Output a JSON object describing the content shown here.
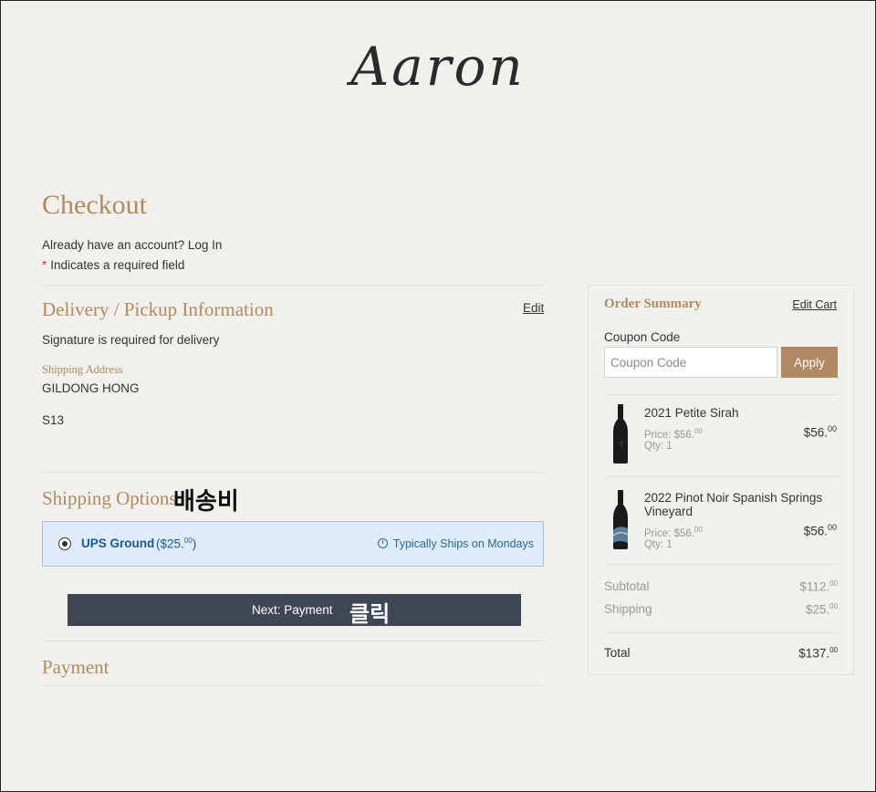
{
  "brand": {
    "logo": "Aaron"
  },
  "page": {
    "title": "Checkout",
    "account_prompt": "Already have an account?",
    "login_link": "Log In",
    "required_star": "*",
    "required_note": "Indicates a required field"
  },
  "delivery": {
    "title": "Delivery / Pickup Information",
    "edit_label": "Edit",
    "signature_note": "Signature is required for delivery",
    "address_label": "Shipping Address",
    "recipient": "GILDONG HONG",
    "address_line": "S13"
  },
  "shipping": {
    "title": "Shipping Options",
    "annotation": "배송비",
    "option": {
      "name": "UPS Ground",
      "price": "($25.",
      "price_cents": "00",
      "price_close": ")",
      "note": "Typically Ships on Mondays"
    }
  },
  "next_button": {
    "label": "Next: Payment",
    "annotation": "클릭"
  },
  "payment": {
    "title": "Payment"
  },
  "summary": {
    "title": "Order Summary",
    "edit_cart": "Edit Cart",
    "coupon_label": "Coupon Code",
    "coupon_placeholder": "Coupon Code",
    "apply_label": "Apply",
    "items": [
      {
        "name": "2021 Petite Sirah",
        "price_label": "Price: $56.",
        "price_cents": "00",
        "qty_label": "Qty: 1",
        "total": "$56.",
        "total_cents": "00"
      },
      {
        "name": "2022 Pinot Noir Spanish Springs Vineyard",
        "price_label": "Price: $56.",
        "price_cents": "00",
        "qty_label": "Qty: 1",
        "total": "$56.",
        "total_cents": "00"
      }
    ],
    "subtotal_label": "Subtotal",
    "subtotal": "$112.",
    "subtotal_cents": "00",
    "shipping_label": "Shipping",
    "shipping": "$25.",
    "shipping_cents": "00",
    "total_label": "Total",
    "total": "$137.",
    "total_cents": "00"
  },
  "colors": {
    "accent": "#b08a62",
    "background": "#f1f0ed",
    "button_dark": "#3e4753",
    "option_bg": "#deebf8",
    "option_text": "#1c5a8c"
  },
  "icons": [
    "clock-icon",
    "radio-selected-icon",
    "wine-bottle-icon"
  ]
}
